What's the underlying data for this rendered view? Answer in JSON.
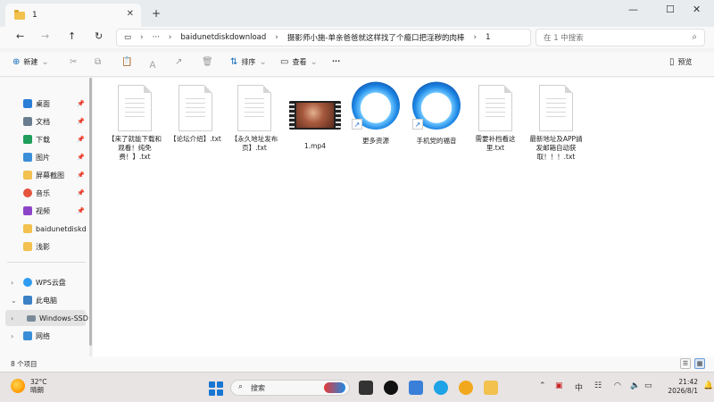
{
  "tab": {
    "title": "1",
    "close": "✕",
    "new": "+"
  },
  "window_controls": {
    "minimize": "—",
    "maximize": "☐",
    "close": "✕"
  },
  "nav": {
    "back": "←",
    "forward": "→",
    "up": "↑",
    "refresh": "↻",
    "more": "···"
  },
  "address": {
    "segments": [
      "baidunetdiskdownload",
      "摄影师小施-单亲爸爸就这样找了个瘾口把淫秽的肉棒",
      "1"
    ]
  },
  "search": {
    "placeholder": "在 1 中搜索"
  },
  "toolbar": {
    "new_label": "新建",
    "sort_label": "排序",
    "view_label": "查看",
    "more": "···",
    "preview_label": "预览"
  },
  "sidebar": {
    "items": [
      {
        "label": "桌面",
        "pinned": true
      },
      {
        "label": "文档",
        "pinned": true
      },
      {
        "label": "下载",
        "pinned": true
      },
      {
        "label": "图片",
        "pinned": true
      },
      {
        "label": "屏幕截图",
        "pinned": true
      },
      {
        "label": "音乐",
        "pinned": true
      },
      {
        "label": "视频",
        "pinned": true
      },
      {
        "label": "baidunetdiskdo",
        "pinned": false
      },
      {
        "label": "浅影",
        "pinned": false
      },
      {
        "label": "WPS云盘",
        "pinned": false
      },
      {
        "label": "此电脑",
        "pinned": false
      },
      {
        "label": "Windows-SSD",
        "pinned": false
      },
      {
        "label": "网络",
        "pinned": false
      }
    ]
  },
  "files": [
    {
      "name": "【来了就能下载和观看！纯免费！】.txt",
      "type": "txt"
    },
    {
      "name": "【论坛介绍】.txt",
      "type": "txt"
    },
    {
      "name": "【永久地址发布页】.txt",
      "type": "txt"
    },
    {
      "name": "1.mp4",
      "type": "video"
    },
    {
      "name": "更多资源",
      "type": "shortcut"
    },
    {
      "name": "手机党的福音",
      "type": "shortcut"
    },
    {
      "name": "需要补档看这里.txt",
      "type": "txt"
    },
    {
      "name": "最新地址及APP請发邮箱自动获取！！！.txt",
      "type": "txt"
    }
  ],
  "status": {
    "count": "8 个项目"
  },
  "taskbar": {
    "weather_temp": "32°C",
    "weather_desc": "晴朗",
    "search_label": "搜索",
    "time": "21:42",
    "date": "2026/8/1",
    "tray_lang": "中"
  }
}
